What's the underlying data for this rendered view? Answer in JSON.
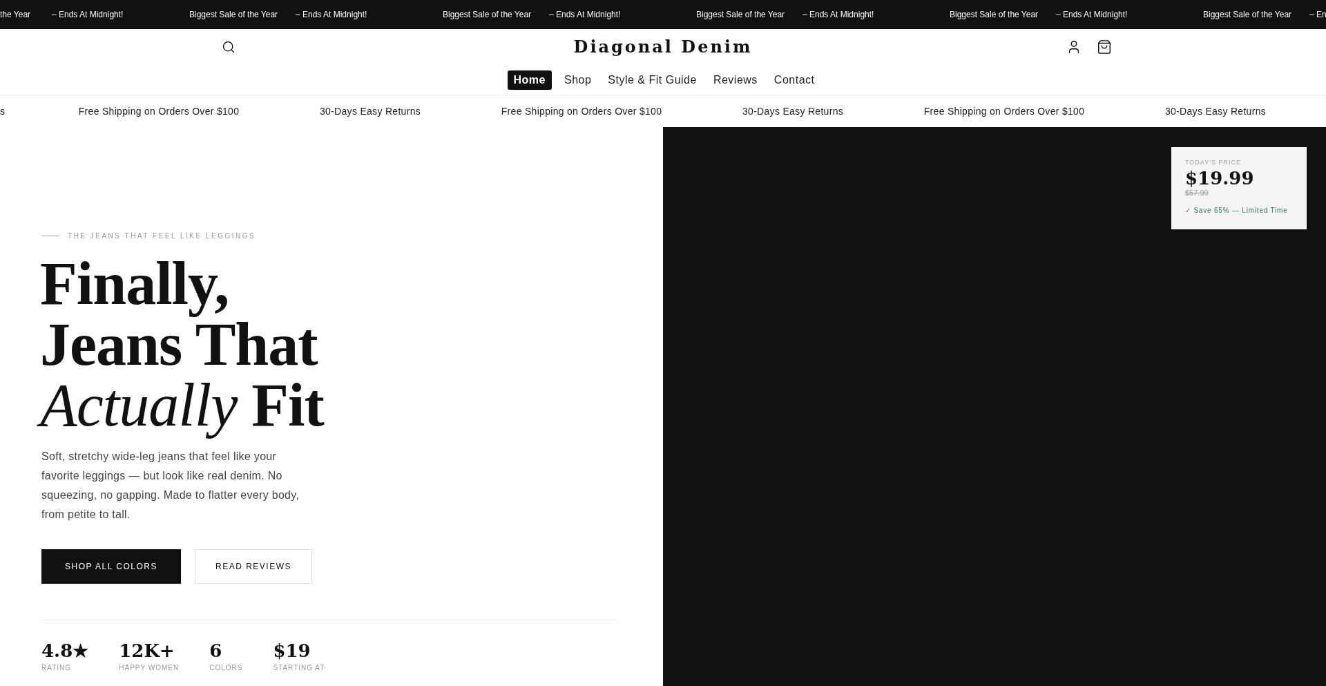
{
  "announcement_bar": {
    "lead_cut": [
      "the Year",
      "– Ends At Midnight!"
    ],
    "items": [
      {
        "text": "Biggest Sale of the Year",
        "note": "– Ends At Midnight!"
      },
      {
        "text": "Biggest Sale of the Year",
        "note": "– Ends At Midnight!"
      },
      {
        "text": "Biggest Sale of the Year",
        "note": "– Ends At Midnight!"
      },
      {
        "text": "Biggest Sale of the Year",
        "note": "– Ends At Midnight!"
      },
      {
        "text": "Biggest Sale of the Year",
        "note": "– En"
      }
    ]
  },
  "header": {
    "logo": "Diagonal Denim"
  },
  "nav": [
    {
      "label": "Home",
      "selected": true
    },
    {
      "label": "Shop",
      "selected": false
    },
    {
      "label": "Style & Fit Guide",
      "selected": false
    },
    {
      "label": "Reviews",
      "selected": false
    },
    {
      "label": "Contact",
      "selected": false
    }
  ],
  "perks_bar": {
    "lead_cut": "s",
    "items": [
      "Free Shipping on Orders Over $100",
      "30-Days Easy Returns",
      "Free Shipping on Orders Over $100",
      "30-Days Easy Returns",
      "Free Shipping on Orders Over $100",
      "30-Days Easy Returns"
    ]
  },
  "hero": {
    "eyebrow": "THE JEANS THAT FEEL LIKE LEGGINGS",
    "headline": [
      "Finally,",
      "Jeans That"
    ],
    "headline_italic": "Actually",
    "headline_end": "Fit",
    "body": "Soft, stretchy wide-leg jeans that feel like your favorite leggings — but look like real denim. No squeezing, no gapping. Made to flatter every body, from petite to tall.",
    "buttons": [
      {
        "label": "SHOP ALL COLORS",
        "kind": "primary"
      },
      {
        "label": "READ REVIEWS",
        "kind": "secondary"
      }
    ],
    "stats": [
      {
        "value": "4.8★",
        "label": "RATING"
      },
      {
        "value": "12K+",
        "label": "HAPPY WOMEN"
      },
      {
        "value": "6",
        "label": "COLORS"
      },
      {
        "value": "$19",
        "label": "STARTING AT"
      }
    ]
  },
  "price_card": {
    "label": "TODAY'S PRICE",
    "price": "$19.99",
    "old_price": "$57.99",
    "savings": "✓ Save 65% — Limited Time"
  }
}
